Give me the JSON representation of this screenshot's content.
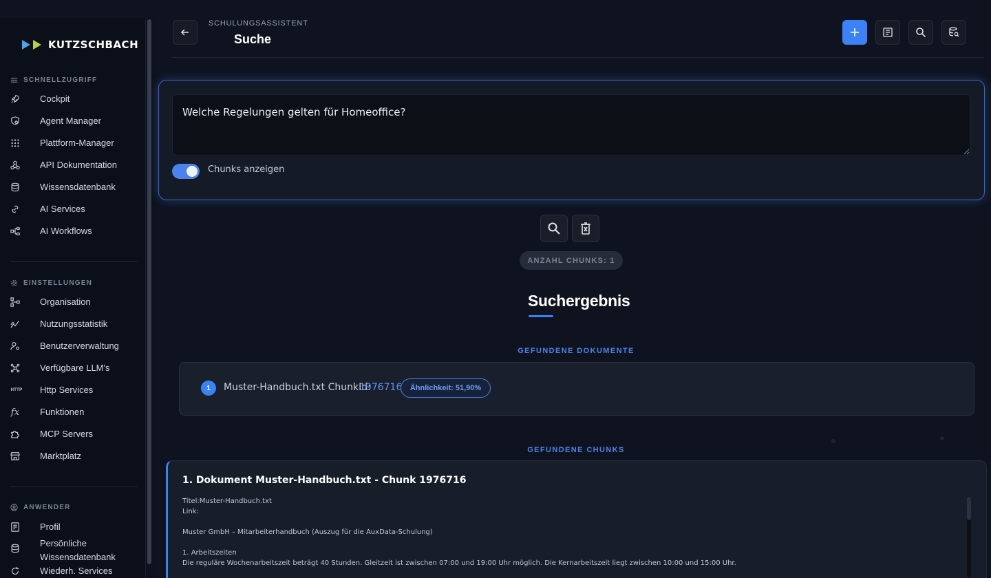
{
  "brand": {
    "name": "KUTZSCHBACH"
  },
  "sidebar": {
    "sections": [
      {
        "title": "SCHNELLZUGRIFF",
        "items": [
          {
            "label": "Cockpit",
            "icon": "rocket-icon"
          },
          {
            "label": "Agent Manager",
            "icon": "shield-gear-icon"
          },
          {
            "label": "Plattform-Manager",
            "icon": "grid-dots-icon"
          },
          {
            "label": "API Dokumentation",
            "icon": "webhook-icon"
          },
          {
            "label": "Wissensdatenbank",
            "icon": "database-icon"
          },
          {
            "label": "AI Services",
            "icon": "link-chain-icon"
          },
          {
            "label": "AI Workflows",
            "icon": "workflow-icon"
          }
        ]
      },
      {
        "title": "EINSTELLUNGEN",
        "items": [
          {
            "label": "Organisation",
            "icon": "hierarchy-icon"
          },
          {
            "label": "Nutzungsstatistik",
            "icon": "chart-line-icon"
          },
          {
            "label": "Benutzerverwaltung",
            "icon": "user-settings-icon"
          },
          {
            "label": "Verfügbare LLM's",
            "icon": "network-icon"
          },
          {
            "label": "Http Services",
            "icon": "http-icon"
          },
          {
            "label": "Funktionen",
            "icon": "function-icon"
          },
          {
            "label": "MCP Servers",
            "icon": "puzzle-icon"
          },
          {
            "label": "Marktplatz",
            "icon": "store-icon"
          }
        ]
      },
      {
        "title": "ANWENDER",
        "items": [
          {
            "label": "Profil",
            "icon": "profile-card-icon"
          },
          {
            "label": "Persönliche Wissensdatenbank",
            "line1": "Persönliche",
            "line2": "Wissensdatenbank",
            "icon": "database-icon"
          },
          {
            "label": "Wiederh. Services",
            "icon": "refresh-icon"
          }
        ]
      }
    ]
  },
  "header": {
    "kicker": "SCHULUNGSASSISTENT",
    "title": "Suche"
  },
  "search": {
    "query": "Welche Regelungen gelten für Homeoffice?",
    "toggle_label": "Chunks anzeigen",
    "toggle_on": true
  },
  "results": {
    "chunk_count": "ANZAHL CHUNKS: 1",
    "title": "Suchergebnis",
    "documents_label": "GEFUNDENE DOKUMENTE",
    "chunks_label": "GEFUNDENE CHUNKS",
    "documents": [
      {
        "index": "1",
        "name": "Muster-Handbuch.txt ChunkId:",
        "chunk_id": "1976716",
        "similarity": "Ähnlichkeit: 51,90%"
      }
    ],
    "chunks": [
      {
        "title": "1. Dokument Muster-Handbuch.txt - Chunk 1976716",
        "lines": [
          "Titel:Muster-Handbuch.txt",
          "Link:",
          "Muster GmbH – Mitarbeiterhandbuch (Auszug für die AuxData-Schulung)",
          "1. Arbeitszeiten",
          "Die reguläre Wochenarbeitszeit beträgt 40 Stunden. Gleitzeit ist zwischen 07:00 und 19:00 Uhr möglich. Die Kernarbeitszeit liegt zwischen 10:00 und 15:00 Uhr."
        ]
      }
    ]
  },
  "colors": {
    "accent": "#3b82f6",
    "background": "#0f1320",
    "sidebar": "#0b0f1a"
  }
}
